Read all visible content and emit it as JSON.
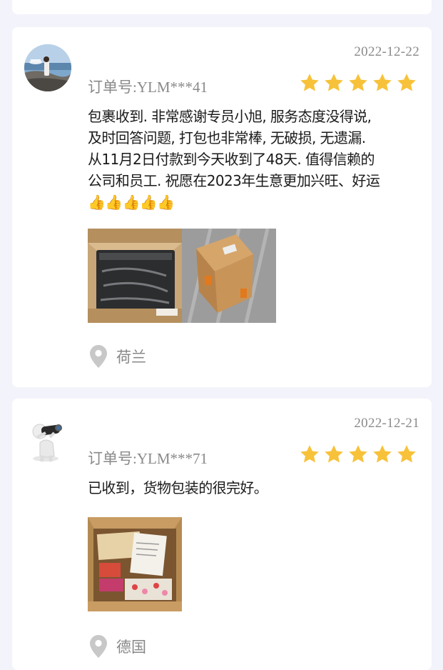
{
  "colors": {
    "page_bg": "#f3f3fb",
    "card_bg": "#ffffff",
    "muted_text": "#8a8a8a",
    "star": "#f7c23a",
    "pin": "#c8c8c8"
  },
  "reviews": [
    {
      "avatar_icon": "photo-avatar-seaside",
      "date": "2022-12-22",
      "order_label": "订单号:",
      "order_no": "YLM***41",
      "rating": 5,
      "text_lines": [
        "包裹收到. 非常感谢专员小旭, 服务态度没得说,",
        "及时回答问题, 打包也非常棒, 无破损, 无遗漏.",
        "从11月2日付款到今天收到了48天. 值得信赖的",
        "公司和员工. 祝愿在2023年生意更加兴旺、好运"
      ],
      "emoji": "👍👍👍👍👍",
      "photos": [
        "opened-box-photo",
        "sealed-box-photo"
      ],
      "location": "荷兰"
    },
    {
      "avatar_icon": "binoculars-figure-avatar",
      "date": "2022-12-21",
      "order_label": "订单号:",
      "order_no": "YLM***71",
      "rating": 5,
      "text_lines": [
        "已收到，货物包装的很完好。"
      ],
      "photos": [
        "package-contents-photo"
      ],
      "location": "德国"
    }
  ]
}
